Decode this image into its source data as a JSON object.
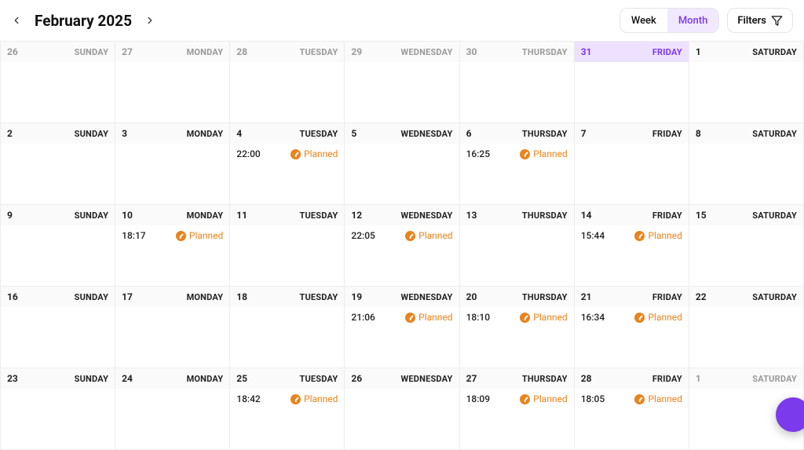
{
  "header": {
    "title": "February 2025",
    "view_week": "Week",
    "view_month": "Month",
    "filters": "Filters"
  },
  "status_label": "Planned",
  "status_color": "#e8841d",
  "accent_color": "#7c3aed",
  "weeks": [
    [
      {
        "num": "26",
        "name": "SUNDAY",
        "other": true,
        "today": false,
        "events": []
      },
      {
        "num": "27",
        "name": "MONDAY",
        "other": true,
        "today": false,
        "events": []
      },
      {
        "num": "28",
        "name": "TUESDAY",
        "other": true,
        "today": false,
        "events": []
      },
      {
        "num": "29",
        "name": "WEDNESDAY",
        "other": true,
        "today": false,
        "events": []
      },
      {
        "num": "30",
        "name": "THURSDAY",
        "other": true,
        "today": false,
        "events": []
      },
      {
        "num": "31",
        "name": "FRIDAY",
        "other": true,
        "today": true,
        "events": []
      },
      {
        "num": "1",
        "name": "SATURDAY",
        "other": false,
        "today": false,
        "events": []
      }
    ],
    [
      {
        "num": "2",
        "name": "SUNDAY",
        "other": false,
        "today": false,
        "events": []
      },
      {
        "num": "3",
        "name": "MONDAY",
        "other": false,
        "today": false,
        "events": []
      },
      {
        "num": "4",
        "name": "TUESDAY",
        "other": false,
        "today": false,
        "events": [
          {
            "time": "22:00"
          }
        ]
      },
      {
        "num": "5",
        "name": "WEDNESDAY",
        "other": false,
        "today": false,
        "events": []
      },
      {
        "num": "6",
        "name": "THURSDAY",
        "other": false,
        "today": false,
        "events": [
          {
            "time": "16:25"
          }
        ]
      },
      {
        "num": "7",
        "name": "FRIDAY",
        "other": false,
        "today": false,
        "events": []
      },
      {
        "num": "8",
        "name": "SATURDAY",
        "other": false,
        "today": false,
        "events": []
      }
    ],
    [
      {
        "num": "9",
        "name": "SUNDAY",
        "other": false,
        "today": false,
        "events": []
      },
      {
        "num": "10",
        "name": "MONDAY",
        "other": false,
        "today": false,
        "events": [
          {
            "time": "18:17"
          }
        ]
      },
      {
        "num": "11",
        "name": "TUESDAY",
        "other": false,
        "today": false,
        "events": []
      },
      {
        "num": "12",
        "name": "WEDNESDAY",
        "other": false,
        "today": false,
        "events": [
          {
            "time": "22:05"
          }
        ]
      },
      {
        "num": "13",
        "name": "THURSDAY",
        "other": false,
        "today": false,
        "events": []
      },
      {
        "num": "14",
        "name": "FRIDAY",
        "other": false,
        "today": false,
        "events": [
          {
            "time": "15:44"
          }
        ]
      },
      {
        "num": "15",
        "name": "SATURDAY",
        "other": false,
        "today": false,
        "events": []
      }
    ],
    [
      {
        "num": "16",
        "name": "SUNDAY",
        "other": false,
        "today": false,
        "events": []
      },
      {
        "num": "17",
        "name": "MONDAY",
        "other": false,
        "today": false,
        "events": []
      },
      {
        "num": "18",
        "name": "TUESDAY",
        "other": false,
        "today": false,
        "events": []
      },
      {
        "num": "19",
        "name": "WEDNESDAY",
        "other": false,
        "today": false,
        "events": [
          {
            "time": "21:06"
          }
        ]
      },
      {
        "num": "20",
        "name": "THURSDAY",
        "other": false,
        "today": false,
        "events": [
          {
            "time": "18:10"
          }
        ]
      },
      {
        "num": "21",
        "name": "FRIDAY",
        "other": false,
        "today": false,
        "events": [
          {
            "time": "16:34"
          }
        ]
      },
      {
        "num": "22",
        "name": "SATURDAY",
        "other": false,
        "today": false,
        "events": []
      }
    ],
    [
      {
        "num": "23",
        "name": "SUNDAY",
        "other": false,
        "today": false,
        "events": []
      },
      {
        "num": "24",
        "name": "MONDAY",
        "other": false,
        "today": false,
        "events": []
      },
      {
        "num": "25",
        "name": "TUESDAY",
        "other": false,
        "today": false,
        "events": [
          {
            "time": "18:42"
          }
        ]
      },
      {
        "num": "26",
        "name": "WEDNESDAY",
        "other": false,
        "today": false,
        "events": []
      },
      {
        "num": "27",
        "name": "THURSDAY",
        "other": false,
        "today": false,
        "events": [
          {
            "time": "18:09"
          }
        ]
      },
      {
        "num": "28",
        "name": "FRIDAY",
        "other": false,
        "today": false,
        "events": [
          {
            "time": "18:05"
          }
        ]
      },
      {
        "num": "1",
        "name": "SATURDAY",
        "other": true,
        "today": false,
        "events": []
      }
    ]
  ]
}
